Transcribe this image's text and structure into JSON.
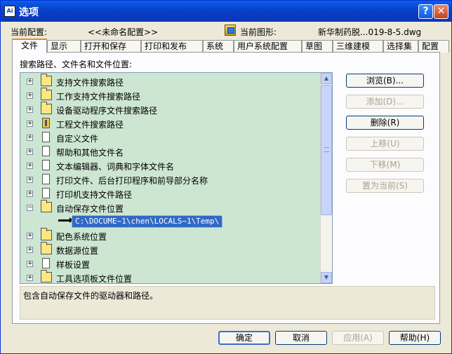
{
  "window": {
    "app_icon": "Ai",
    "title": "选项",
    "help_label": "?",
    "close_label": "✕"
  },
  "config": {
    "current_profile_label": "当前配置:",
    "current_profile_value": "<<未命名配置>>",
    "current_drawing_label": "当前图形:",
    "current_drawing_value": "新华制药脱...019-8-5.dwg"
  },
  "tabs": [
    {
      "label": "文件"
    },
    {
      "label": "显示"
    },
    {
      "label": "打开和保存"
    },
    {
      "label": "打印和发布"
    },
    {
      "label": "系统"
    },
    {
      "label": "用户系统配置"
    },
    {
      "label": "草图"
    },
    {
      "label": "三维建模"
    },
    {
      "label": "选择集"
    },
    {
      "label": "配置"
    }
  ],
  "panel": {
    "section_label": "搜索路径、文件名和文件位置:",
    "tree_items": [
      {
        "label": "支持文件搜索路径",
        "icon": "folder-icon",
        "expander": "+"
      },
      {
        "label": "工作支持文件搜索路径",
        "icon": "folder-icon",
        "expander": "+"
      },
      {
        "label": "设备驱动程序文件搜索路径",
        "icon": "folder-icon",
        "expander": "+"
      },
      {
        "label": "工程文件搜索路径",
        "icon": "book-icon",
        "expander": "+"
      },
      {
        "label": "自定义文件",
        "icon": "document-icon",
        "expander": "+"
      },
      {
        "label": "帮助和其他文件名",
        "icon": "document-icon",
        "expander": "+"
      },
      {
        "label": "文本编辑器、词典和字体文件名",
        "icon": "document-icon",
        "expander": "+"
      },
      {
        "label": "打印文件、后台打印程序和前导部分名称",
        "icon": "document-icon",
        "expander": "+"
      },
      {
        "label": "打印机支持文件路径",
        "icon": "document-icon",
        "expander": "+"
      },
      {
        "label": "自动保存文件位置",
        "icon": "folder-icon",
        "expander": "−"
      },
      {
        "label": "配色系统位置",
        "icon": "folder-icon",
        "expander": "+"
      },
      {
        "label": "数据源位置",
        "icon": "folder-icon",
        "expander": "+"
      },
      {
        "label": "样板设置",
        "icon": "document-icon",
        "expander": "+"
      },
      {
        "label": "工具选项板文件位置",
        "icon": "folder-icon",
        "expander": "+"
      }
    ],
    "selected_path": "C:\\DOCUME~1\\chen\\LOCALS~1\\Temp\\",
    "description": "包含自动保存文件的驱动器和路径。"
  },
  "side_buttons": {
    "browse": "浏览(B)...",
    "add": "添加(D)...",
    "remove": "删除(R)",
    "move_up": "上移(U)",
    "move_down": "下移(M)",
    "set_current": "置为当前(S)"
  },
  "footer": {
    "ok": "确定",
    "cancel": "取消",
    "apply": "应用(A)",
    "help": "帮助(H)"
  },
  "colors": {
    "titlebar": "#0a3fc9",
    "tree_background": "#cde6d2",
    "selection": "#316ac5",
    "active_tab_accent": "#e68b2c"
  }
}
